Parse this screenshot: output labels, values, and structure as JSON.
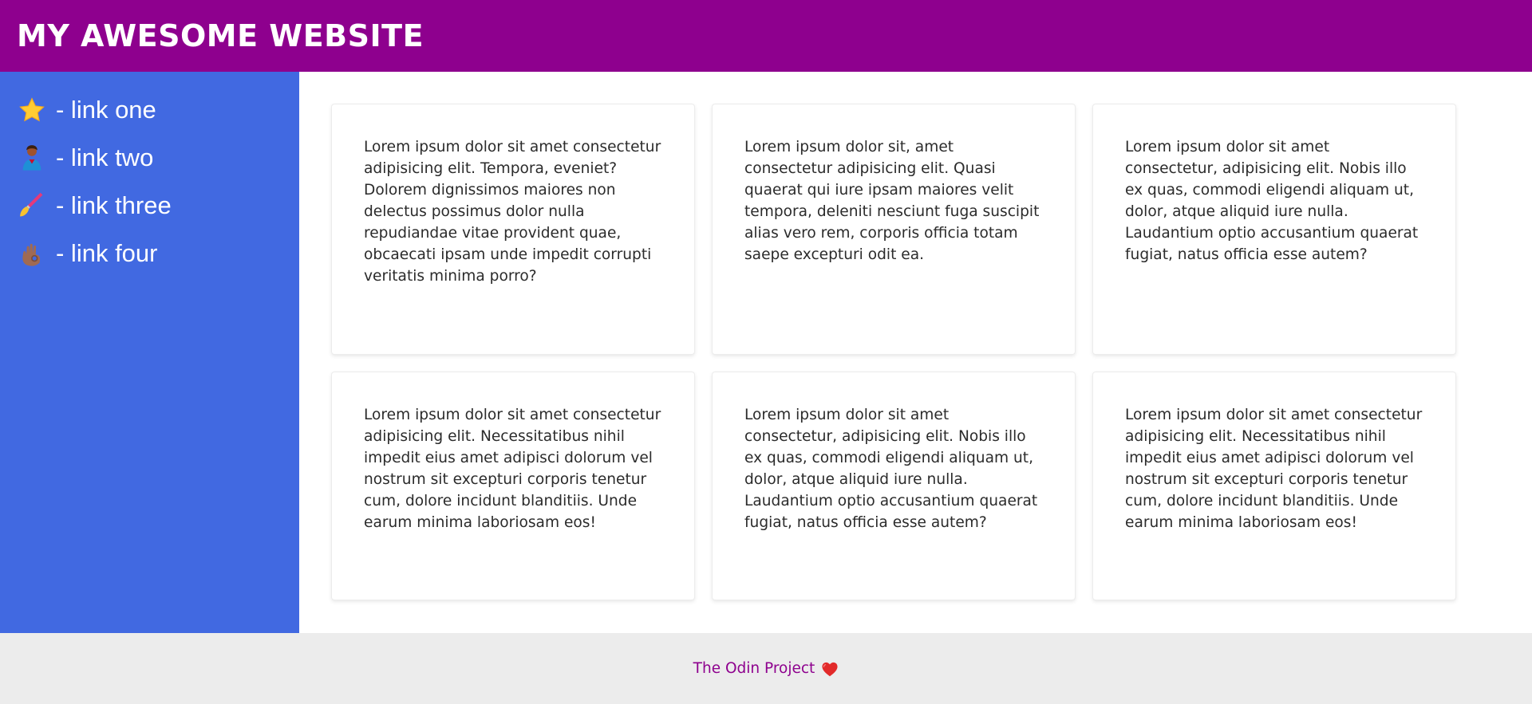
{
  "header": {
    "title": "MY AWESOME WEBSITE"
  },
  "sidebar": {
    "items": [
      {
        "icon": "star-icon",
        "label": "- link one"
      },
      {
        "icon": "person-icon",
        "label": "- link two"
      },
      {
        "icon": "paintbrush-icon",
        "label": "- link three"
      },
      {
        "icon": "ok-hand-icon",
        "label": "- link four"
      }
    ]
  },
  "cards": [
    {
      "text": "Lorem ipsum dolor sit amet consectetur adipisicing elit. Tempora, eveniet? Dolorem dignissimos maiores non delectus possimus dolor nulla repudiandae vitae provident quae, obcaecati ipsam unde impedit corrupti veritatis minima porro?"
    },
    {
      "text": "Lorem ipsum dolor sit, amet consectetur adipisicing elit. Quasi quaerat qui iure ipsam maiores velit tempora, deleniti nesciunt fuga suscipit alias vero rem, corporis officia totam saepe excepturi odit ea."
    },
    {
      "text": "Lorem ipsum dolor sit amet consectetur, adipisicing elit. Nobis illo ex quas, commodi eligendi aliquam ut, dolor, atque aliquid iure nulla. Laudantium optio accusantium quaerat fugiat, natus officia esse autem?"
    },
    {
      "text": "Lorem ipsum dolor sit amet consectetur adipisicing elit. Necessitatibus nihil impedit eius amet adipisci dolorum vel nostrum sit excepturi corporis tenetur cum, dolore incidunt blanditiis. Unde earum minima laboriosam eos!"
    },
    {
      "text": "Lorem ipsum dolor sit amet consectetur, adipisicing elit. Nobis illo ex quas, commodi eligendi aliquam ut, dolor, atque aliquid iure nulla. Laudantium optio accusantium quaerat fugiat, natus officia esse autem?"
    },
    {
      "text": "Lorem ipsum dolor sit amet consectetur adipisicing elit. Necessitatibus nihil impedit eius amet adipisci dolorum vel nostrum sit excepturi corporis tenetur cum, dolore incidunt blanditiis. Unde earum minima laboriosam eos!"
    }
  ],
  "footer": {
    "text": "The Odin Project",
    "icon": "heart-icon"
  },
  "colors": {
    "header_bg": "#8e008e",
    "sidebar_bg": "#4169e1",
    "footer_bg": "#ececec",
    "footer_text": "#8e008e"
  }
}
